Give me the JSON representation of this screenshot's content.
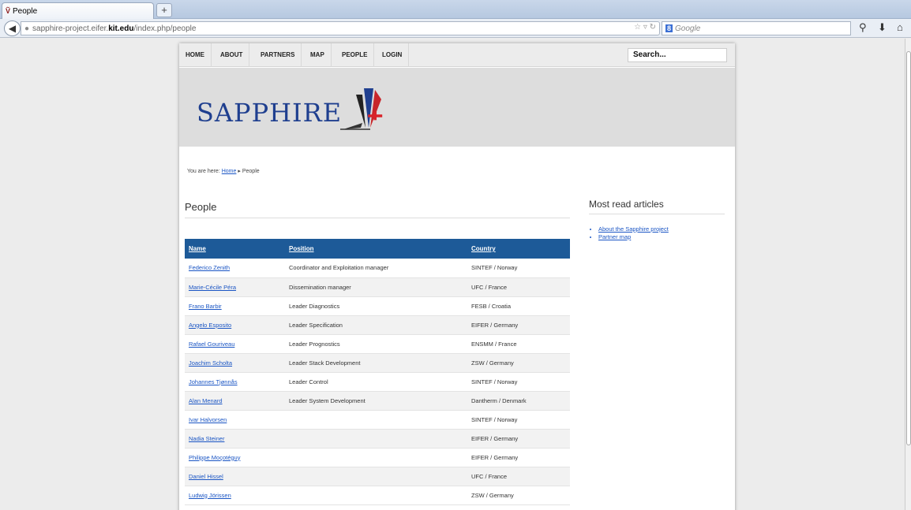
{
  "browser": {
    "tab_title": "People",
    "tab_favicon": "Ṽ",
    "new_tab_label": "+",
    "url_prefix": "sapphire-project.eifer.",
    "url_domain": "kit.edu",
    "url_path": "/index.php/people",
    "search_engine_badge": "8",
    "search_placeholder": "Google"
  },
  "nav": {
    "items": [
      "HOME",
      "ABOUT",
      "PARTNERS",
      "MAP",
      "PEOPLE",
      "LOGIN"
    ],
    "search_value": "Search..."
  },
  "banner": {
    "logo_text": "SAPPHIRE"
  },
  "breadcrumb": {
    "prefix": "You are here:",
    "home": "Home",
    "separator": "▸",
    "current": "People"
  },
  "page_title": "People",
  "table": {
    "headers": [
      "Name",
      "Position",
      "Country"
    ],
    "rows": [
      {
        "name": "Federico Zenith",
        "position": "Coordinator and Exploitation manager",
        "country": "SINTEF / Norway"
      },
      {
        "name": "Marie-Cécile Péra",
        "position": "Dissemination manager",
        "country": "UFC / France"
      },
      {
        "name": "Frano Barbir",
        "position": "Leader Diagnostics",
        "country": "FESB / Croatia"
      },
      {
        "name": "Angelo Esposito",
        "position": "Leader Specification",
        "country": "EIFER / Germany"
      },
      {
        "name": "Rafael Gouriveau",
        "position": "Leader Prognostics",
        "country": "ENSMM / France"
      },
      {
        "name": "Joachim Scholta",
        "position": "Leader Stack Development",
        "country": "ZSW / Germany"
      },
      {
        "name": "Johannes Tjønnås",
        "position": "Leader Control",
        "country": "SINTEF / Norway"
      },
      {
        "name": "Alan Menard",
        "position": "Leader System Development",
        "country": "Dantherm / Denmark"
      },
      {
        "name": "Ivar Halvorsen",
        "position": "",
        "country": "SINTEF / Norway"
      },
      {
        "name": "Nadia Steiner",
        "position": "",
        "country": "EIFER / Germany"
      },
      {
        "name": "Philippe Moçotéguy",
        "position": "",
        "country": "EIFER / Germany"
      },
      {
        "name": "Daniel Hissel",
        "position": "",
        "country": "UFC / France"
      },
      {
        "name": "Ludwig Jörissen",
        "position": "",
        "country": "ZSW / Germany"
      }
    ]
  },
  "sidebar": {
    "title": "Most read articles",
    "links": [
      "About the Sapphire project",
      "Partner map"
    ]
  },
  "colors": {
    "table_header": "#1d5a98",
    "link": "#1a55c4",
    "logo": "#1f3f8f"
  }
}
